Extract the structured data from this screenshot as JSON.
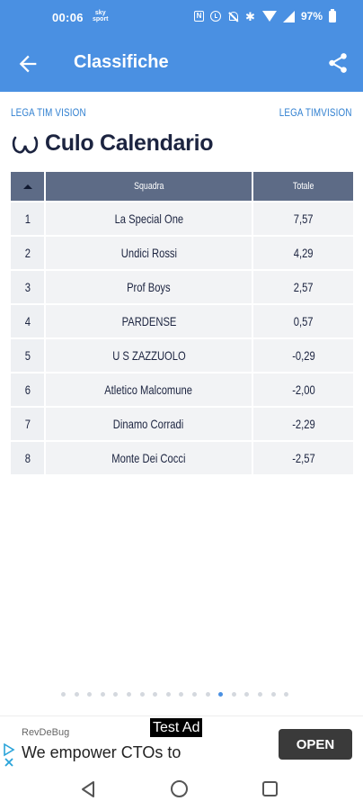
{
  "status_bar": {
    "time": "00:06",
    "brand_top": "sky",
    "brand_bottom": "sport",
    "battery": "97%"
  },
  "app_bar": {
    "title": "Classifiche",
    "back_icon": "arrow-left-icon",
    "share_icon": "share-icon"
  },
  "league": {
    "left_label": "LEGA TIM VISION",
    "right_label": "LEGA TIMVISION"
  },
  "section": {
    "icon": "horseshoe-icon",
    "title": "Culo Calendario"
  },
  "table": {
    "headers": {
      "position": "",
      "team": "Squadra",
      "total": "Totale"
    },
    "rows": [
      {
        "pos": "1",
        "team": "La Special One",
        "total": "7,57"
      },
      {
        "pos": "2",
        "team": "Undici Rossi",
        "total": "4,29"
      },
      {
        "pos": "3",
        "team": "Prof Boys",
        "total": "2,57"
      },
      {
        "pos": "4",
        "team": "PARDENSE",
        "total": "0,57"
      },
      {
        "pos": "5",
        "team": "U S ZAZZUOLO",
        "total": "-0,29"
      },
      {
        "pos": "6",
        "team": "Atletico Malcomune",
        "total": "-2,00"
      },
      {
        "pos": "7",
        "team": "Dinamo Corradi",
        "total": "-2,29"
      },
      {
        "pos": "8",
        "team": "Monte Dei Cocci",
        "total": "-2,57"
      }
    ]
  },
  "pager": {
    "total_dots": 18,
    "active_index": 12
  },
  "ad": {
    "badge": "Test Ad",
    "advertiser": "RevDeBug",
    "headline": "We empower CTOs to",
    "cta": "OPEN"
  },
  "colors": {
    "primary": "#4a90e2",
    "header_cell": "#5d6b86",
    "row_bg": "#f2f3f5",
    "text_dark": "#1c2440",
    "league_text": "#2f7fd0"
  }
}
